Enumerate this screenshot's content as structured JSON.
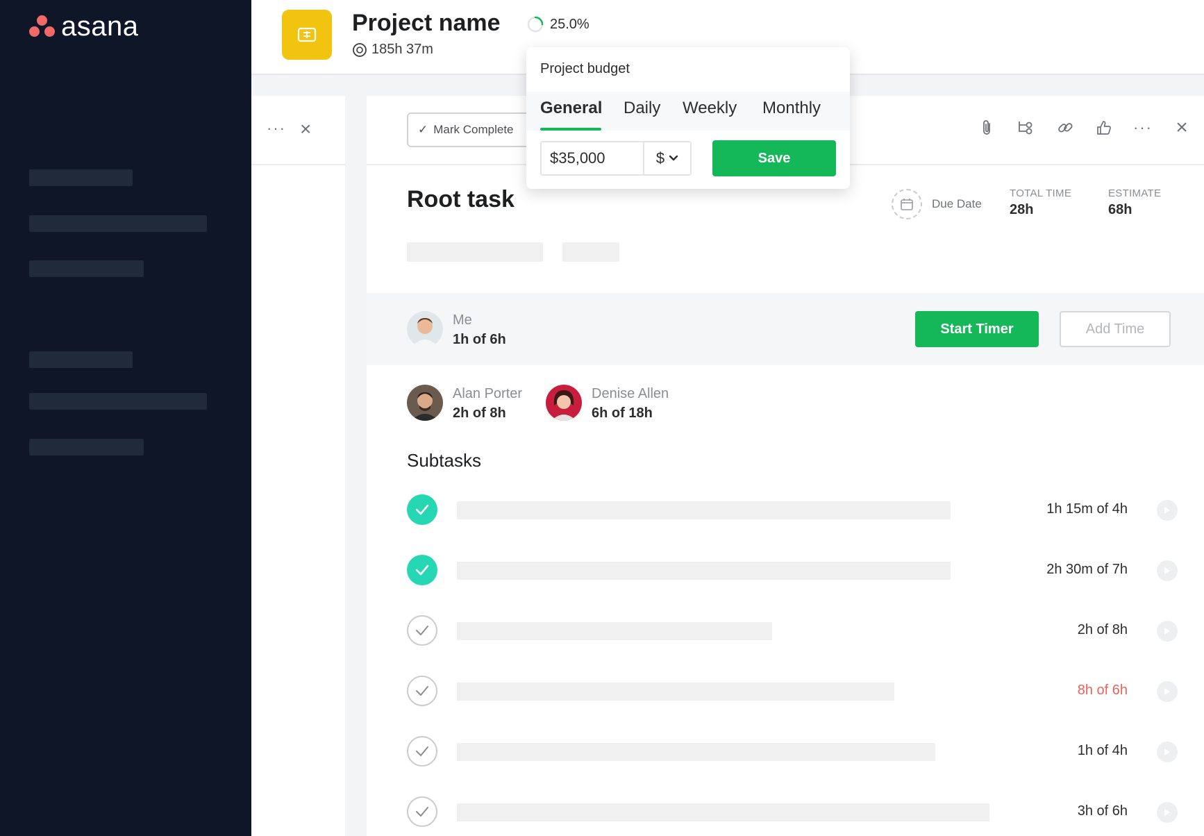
{
  "app": {
    "logo_text": "asana"
  },
  "header": {
    "project_name": "Project name",
    "total_hours": "185h 37m",
    "progress_percent": "25.0%",
    "progress_value": 0.25
  },
  "popover": {
    "title": "Project budget",
    "tabs": [
      "General",
      "Daily",
      "Weekly",
      "Monthly"
    ],
    "active_tab": "General",
    "budget_value": "$35,000",
    "currency": "$",
    "save_label": "Save"
  },
  "task": {
    "mark_complete_label": "Mark Complete",
    "title": "Root task",
    "due_date_label": "Due Date",
    "total_time_label": "TOTAL TIME",
    "total_time_value": "28h",
    "estimate_label": "ESTIMATE",
    "estimate_value": "68h"
  },
  "me": {
    "name": "Me",
    "time": "1h of 6h",
    "start_timer_label": "Start Timer",
    "add_time_label": "Add Time"
  },
  "assignees": [
    {
      "name": "Alan Porter",
      "time": "2h of 8h"
    },
    {
      "name": "Denise Allen",
      "time": "6h of 18h"
    }
  ],
  "subtasks_title": "Subtasks",
  "subtasks": [
    {
      "done": true,
      "time": "1h 15m of 4h",
      "over": false
    },
    {
      "done": true,
      "time": "2h 30m of 7h",
      "over": false
    },
    {
      "done": false,
      "time": "2h of 8h",
      "over": false
    },
    {
      "done": false,
      "time": "8h of 6h",
      "over": true
    },
    {
      "done": false,
      "time": "1h of 4h",
      "over": false
    },
    {
      "done": false,
      "time": "3h of 6h",
      "over": false
    }
  ],
  "colors": {
    "sidebar": "#0f1627",
    "brand_coral": "#f06a6a",
    "project_icon": "#f1c40f",
    "accent_green": "#14b859",
    "check_done": "#25d8b3",
    "over_red": "#f0605a"
  }
}
